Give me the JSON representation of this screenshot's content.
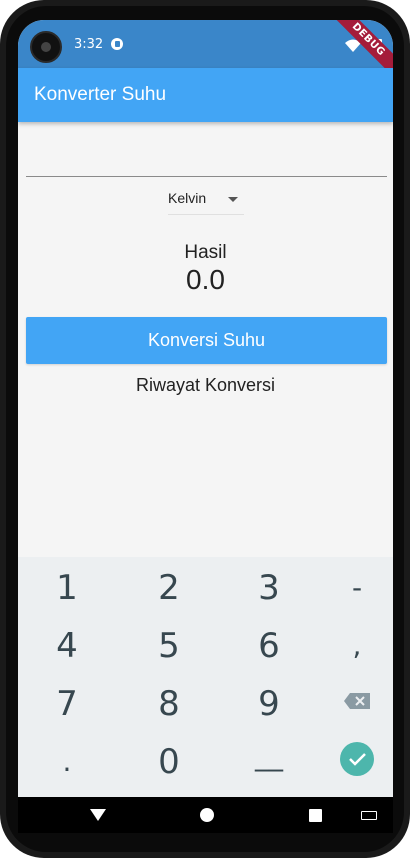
{
  "status_bar": {
    "time": "3:32",
    "debug_banner": "DEBUG"
  },
  "app_bar": {
    "title": "Konverter Suhu"
  },
  "converter": {
    "input_value": "",
    "unit_selected": "Kelvin",
    "result_label": "Hasil",
    "result_value": "0.0",
    "convert_button_label": "Konversi Suhu",
    "history_title": "Riwayat Konversi"
  },
  "keyboard": {
    "rows": [
      [
        "1",
        "2",
        "3",
        "-"
      ],
      [
        "4",
        "5",
        "6",
        ","
      ],
      [
        "7",
        "8",
        "9",
        "backspace"
      ],
      [
        ".",
        "0",
        "_",
        "enter"
      ]
    ],
    "key_labels": {
      "k1": "1",
      "k2": "2",
      "k3": "3",
      "kminus": "-",
      "k4": "4",
      "k5": "5",
      "k6": "6",
      "kcomma": ",",
      "k7": "7",
      "k8": "8",
      "k9": "9",
      "kdot": ".",
      "k0": "0",
      "kspace": "__"
    }
  },
  "colors": {
    "primary": "#42a5f5",
    "status_bar": "#3a86c9",
    "keyboard_bg": "#eceff1",
    "enter_key": "#4db6ac",
    "debug_banner": "#a51c3a"
  },
  "icons": {
    "wifi": "wifi-icon",
    "battery": "battery-icon",
    "backspace": "backspace-icon",
    "enter": "check-icon",
    "nav_back": "back-triangle-icon",
    "nav_home": "home-circle-icon",
    "nav_recent": "recent-square-icon",
    "keyboard_switch": "keyboard-icon"
  }
}
